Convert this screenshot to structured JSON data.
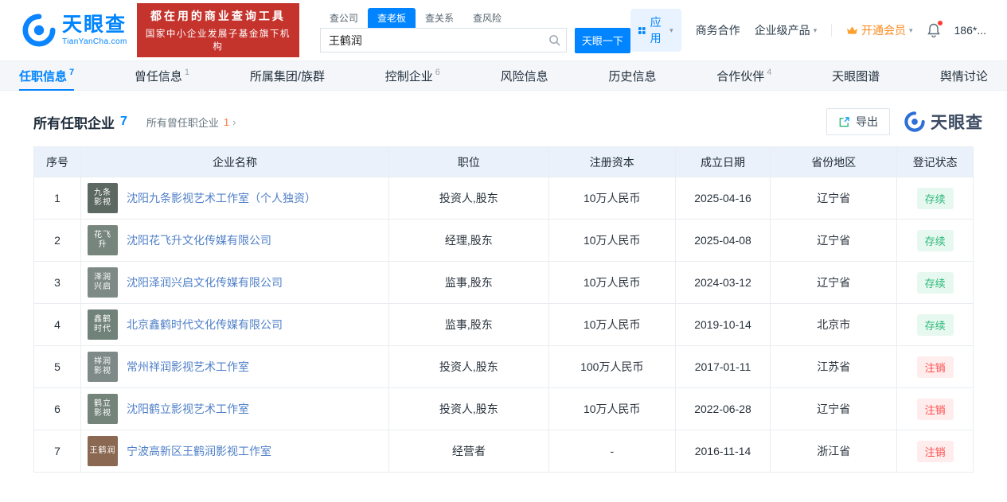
{
  "colors": {
    "accent": "#0084FF",
    "banner_red": "#C5332D",
    "vip_orange": "#FF8A1E",
    "status_active": "#2BB979",
    "status_cancelled": "#FF4A4A",
    "link": "#5080C8"
  },
  "header": {
    "logo_cn": "天眼查",
    "logo_en": "TianYanCha.com",
    "banner_line1": "都在用的商业查询工具",
    "banner_line2": "国家中小企业发展子基金旗下机构",
    "nav_tabs": [
      {
        "label": "查公司",
        "active": false
      },
      {
        "label": "查老板",
        "active": true
      },
      {
        "label": "查关系",
        "active": false
      },
      {
        "label": "查风险",
        "active": false
      }
    ],
    "search": {
      "value": "王鹤润",
      "button": "天眼一下"
    },
    "right": {
      "apps": "应用",
      "biz_coop": "商务合作",
      "enterprise": "企业级产品",
      "vip": "开通会员",
      "phone": "186*..."
    }
  },
  "anchor_tabs": [
    {
      "label": "任职信息",
      "count": "7",
      "active": true
    },
    {
      "label": "曾任信息",
      "count": "1",
      "active": false
    },
    {
      "label": "所属集团/族群",
      "count": "",
      "active": false
    },
    {
      "label": "控制企业",
      "count": "6",
      "active": false
    },
    {
      "label": "风险信息",
      "count": "",
      "active": false
    },
    {
      "label": "历史信息",
      "count": "",
      "active": false
    },
    {
      "label": "合作伙伴",
      "count": "4",
      "active": false
    },
    {
      "label": "天眼图谱",
      "count": "",
      "active": false
    },
    {
      "label": "舆情讨论",
      "count": "",
      "active": false
    }
  ],
  "section": {
    "title": "所有任职企业",
    "title_count": "7",
    "sub_link": "所有曾任职企业",
    "sub_count": "1",
    "export_label": "导出",
    "watermark": "天眼查"
  },
  "table": {
    "headers": [
      "序号",
      "企业名称",
      "职位",
      "注册资本",
      "成立日期",
      "省份地区",
      "登记状态"
    ],
    "rows": [
      {
        "no": "1",
        "icon_lines": [
          "九条",
          "影视"
        ],
        "icon_color": "#5C6862",
        "name": "沈阳九条影视艺术工作室（个人独资）",
        "position": "投资人,股东",
        "capital": "10万人民币",
        "date": "2025-04-16",
        "province": "辽宁省",
        "status": "存续",
        "status_type": "active"
      },
      {
        "no": "2",
        "icon_lines": [
          "花飞",
          "升"
        ],
        "icon_color": "#77867C",
        "name": "沈阳花飞升文化传媒有限公司",
        "position": "经理,股东",
        "capital": "10万人民币",
        "date": "2025-04-08",
        "province": "辽宁省",
        "status": "存续",
        "status_type": "active"
      },
      {
        "no": "3",
        "icon_lines": [
          "泽润",
          "兴启"
        ],
        "icon_color": "#7E8A85",
        "name": "沈阳泽润兴启文化传媒有限公司",
        "position": "监事,股东",
        "capital": "10万人民币",
        "date": "2024-03-12",
        "province": "辽宁省",
        "status": "存续",
        "status_type": "active"
      },
      {
        "no": "4",
        "icon_lines": [
          "鑫鹤",
          "时代"
        ],
        "icon_color": "#71827A",
        "name": "北京鑫鹤时代文化传媒有限公司",
        "position": "监事,股东",
        "capital": "10万人民币",
        "date": "2019-10-14",
        "province": "北京市",
        "status": "存续",
        "status_type": "active"
      },
      {
        "no": "5",
        "icon_lines": [
          "祥润",
          "影视"
        ],
        "icon_color": "#7D8A88",
        "name": "常州祥润影视艺术工作室",
        "position": "投资人,股东",
        "capital": "100万人民币",
        "date": "2017-01-11",
        "province": "江苏省",
        "status": "注销",
        "status_type": "cancelled"
      },
      {
        "no": "6",
        "icon_lines": [
          "鹤立",
          "影视"
        ],
        "icon_color": "#74847B",
        "name": "沈阳鹤立影视艺术工作室",
        "position": "投资人,股东",
        "capital": "10万人民币",
        "date": "2022-06-28",
        "province": "辽宁省",
        "status": "注销",
        "status_type": "cancelled"
      },
      {
        "no": "7",
        "icon_lines": [
          "王鹤润"
        ],
        "icon_color": "#8A6852",
        "name": "宁波高新区王鹤润影视工作室",
        "position": "经营者",
        "capital": "-",
        "date": "2016-11-14",
        "province": "浙江省",
        "status": "注销",
        "status_type": "cancelled"
      }
    ]
  }
}
